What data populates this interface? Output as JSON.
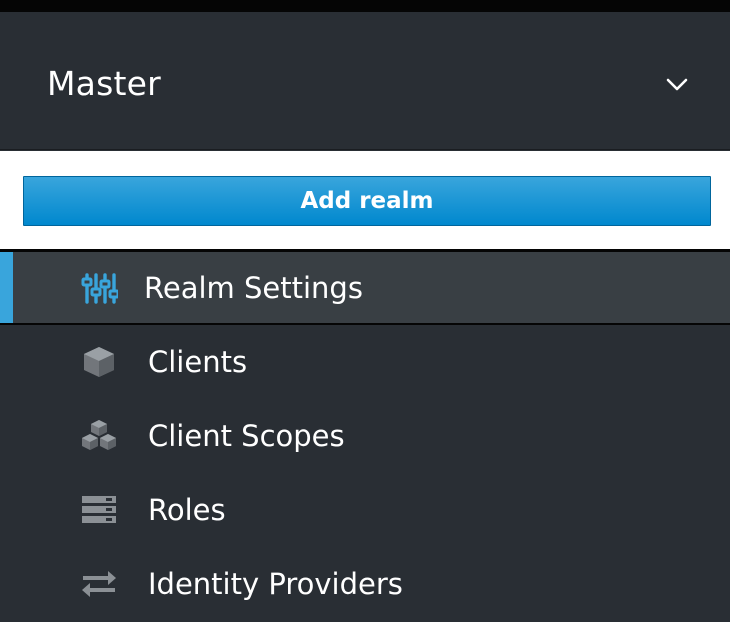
{
  "realm_selector": {
    "current": "Master",
    "chevron_icon": "chevron-down-icon"
  },
  "add_realm": {
    "label": "Add realm",
    "color": "#0088ce"
  },
  "nav": {
    "active_index": 0,
    "accent_color": "#39a5dc",
    "items": [
      {
        "label": "Realm Settings",
        "icon": "sliders-icon",
        "active": true
      },
      {
        "label": "Clients",
        "icon": "cube-icon",
        "active": false
      },
      {
        "label": "Client Scopes",
        "icon": "cubes-icon",
        "active": false
      },
      {
        "label": "Roles",
        "icon": "list-stack-icon",
        "active": false
      },
      {
        "label": "Identity Providers",
        "icon": "exchange-icon",
        "active": false
      }
    ]
  }
}
